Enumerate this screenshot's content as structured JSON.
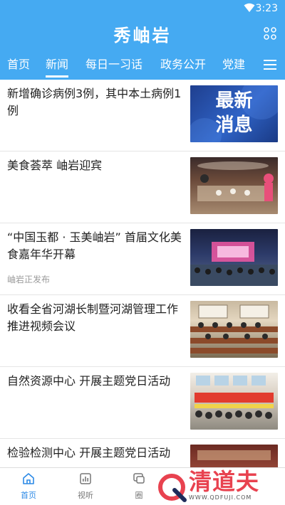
{
  "status_bar": {
    "time": "3:23",
    "wifi_icon": "wifi-icon"
  },
  "header": {
    "app_title": "秀岫岩",
    "grid_icon": "grid-icon",
    "menu_icon": "menu-icon"
  },
  "tabs": [
    {
      "label": "首页",
      "active": false
    },
    {
      "label": "新闻",
      "active": true
    },
    {
      "label": "每日一习话",
      "active": false
    },
    {
      "label": "政务公开",
      "active": false
    },
    {
      "label": "党建",
      "active": false
    }
  ],
  "feed": [
    {
      "title": "新增确诊病例3例，其中本土病例1例",
      "meta": "",
      "thumb": {
        "text_line1": "最新",
        "text_line2": "消息"
      }
    },
    {
      "title": "美食荟萃  岫岩迎宾",
      "meta": ""
    },
    {
      "title": "“中国玉都 · 玉美岫岩” 首届文化美食嘉年华开幕",
      "meta": "岫岩正发布"
    },
    {
      "title": "收看全省河湖长制暨河湖管理工作推进视频会议",
      "meta": ""
    },
    {
      "title": "自然资源中心  开展主题党日活动",
      "meta": ""
    },
    {
      "title": "检验检测中心  开展主题党日活动",
      "meta": ""
    }
  ],
  "bottom_nav": [
    {
      "label": "首页",
      "icon": "home-icon",
      "active": true
    },
    {
      "label": "视听",
      "icon": "video-icon",
      "active": false
    },
    {
      "label": "圈",
      "icon": "chat-icon",
      "active": false
    }
  ],
  "watermark": {
    "text": "清道夫",
    "sub": "WWW.QDFUJI.COM"
  },
  "colors": {
    "primary": "#45aaf2",
    "nav_active": "#2d8ae6",
    "watermark": "#e8424f"
  }
}
